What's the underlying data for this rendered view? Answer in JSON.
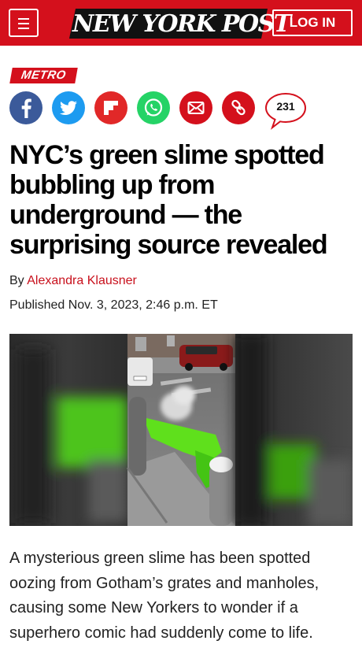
{
  "header": {
    "logo_text": "NEW YORK POST",
    "login_label": "LOG IN",
    "brand_color": "#d4101c",
    "menu_icon": "hamburger-menu-icon"
  },
  "article": {
    "section": "METRO",
    "share_icons": [
      "facebook-icon",
      "twitter-icon",
      "flipboard-icon",
      "whatsapp-icon",
      "email-icon",
      "link-icon"
    ],
    "comment_count": "231",
    "headline": "NYC’s green slime spotted bubbling up from underground — the surprising source revealed",
    "byline_prefix": "By",
    "author": "Alexandra Klausner",
    "published": "Published Nov. 3, 2023, 2:46 p.m. ET",
    "lead_paragraph": "A mysterious green slime has been spotted oozing from Gotham’s grates and manholes, causing some New Yorkers to wonder if a superhero comic had suddenly come to life."
  }
}
